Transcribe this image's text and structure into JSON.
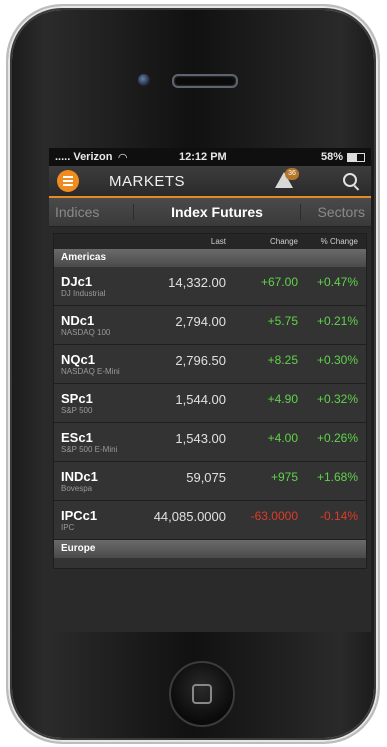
{
  "status": {
    "carrier": "..... Verizon",
    "time": "12:12 PM",
    "battery_text": "58%",
    "battery_level": 0.58
  },
  "appbar": {
    "title": "MARKETS",
    "alert_count": "36",
    "accent": "#f08c1f"
  },
  "tabs": [
    {
      "label": "Indices"
    },
    {
      "label": "Index Futures"
    },
    {
      "label": "Sectors"
    }
  ],
  "columns": {
    "last": "Last",
    "change": "Change",
    "pct": "% Change"
  },
  "sections": [
    {
      "name": "Americas",
      "rows": [
        {
          "symbol": "DJc1",
          "desc": "DJ Industrial",
          "last": "14,332.00",
          "change": "+67.00",
          "pct": "+0.47%",
          "dir": "up"
        },
        {
          "symbol": "NDc1",
          "desc": "NASDAQ 100",
          "last": "2,794.00",
          "change": "+5.75",
          "pct": "+0.21%",
          "dir": "up"
        },
        {
          "symbol": "NQc1",
          "desc": "NASDAQ E-Mini",
          "last": "2,796.50",
          "change": "+8.25",
          "pct": "+0.30%",
          "dir": "up"
        },
        {
          "symbol": "SPc1",
          "desc": "S&P 500",
          "last": "1,544.00",
          "change": "+4.90",
          "pct": "+0.32%",
          "dir": "up"
        },
        {
          "symbol": "ESc1",
          "desc": "S&P 500 E-Mini",
          "last": "1,543.00",
          "change": "+4.00",
          "pct": "+0.26%",
          "dir": "up"
        },
        {
          "symbol": "INDc1",
          "desc": "Bovespa",
          "last": "59,075",
          "change": "+975",
          "pct": "+1.68%",
          "dir": "up"
        },
        {
          "symbol": "IPCc1",
          "desc": "IPC",
          "last": "44,085.0000",
          "change": "-63.0000",
          "pct": "-0.14%",
          "dir": "down"
        }
      ]
    },
    {
      "name": "Europe",
      "rows": []
    }
  ]
}
